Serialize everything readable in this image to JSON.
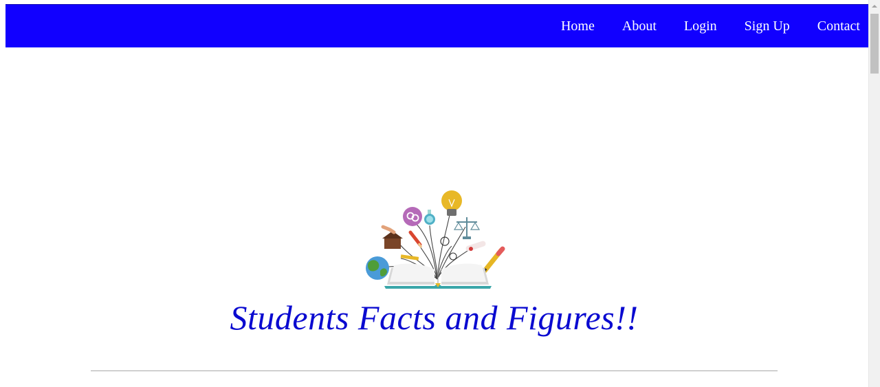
{
  "nav": {
    "items": [
      {
        "label": "Home"
      },
      {
        "label": "About"
      },
      {
        "label": "Login"
      },
      {
        "label": "Sign Up"
      },
      {
        "label": "Contact"
      }
    ],
    "background_color": "#1100ff",
    "text_color": "#ffffff"
  },
  "hero": {
    "logo_icon": "open-book-education-icon",
    "title": "Students Facts and Figures!!",
    "title_color": "#0a0ad0"
  },
  "scrollbar": {
    "arrow_icon": "scroll-up-arrow-icon"
  }
}
